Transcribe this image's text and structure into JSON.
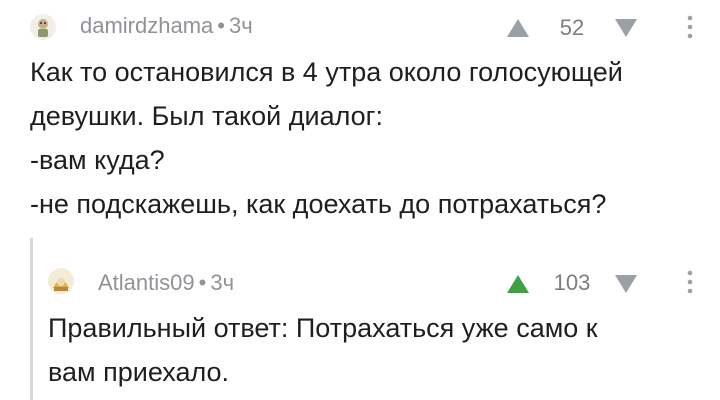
{
  "comment": {
    "author": "damirdzhama",
    "separator": "•",
    "time": "3ч",
    "rating": "52",
    "body": "Как то остановился в 4 утра около голосующей\nдевушки. Был такой диалог:\n-вам куда?\n-не подскажешь, как доехать до потрахаться?",
    "colors": {
      "vote_up": "#9aa0a6",
      "vote_down": "#9aa0a6"
    }
  },
  "reply": {
    "author": "Atlantis09",
    "separator": "•",
    "time": "3ч",
    "rating": "103",
    "body": "Правильный ответ: Потрахаться уже само к\nвам приехало.",
    "colors": {
      "vote_up": "#3fa142",
      "vote_down": "#9aa0a6"
    }
  }
}
